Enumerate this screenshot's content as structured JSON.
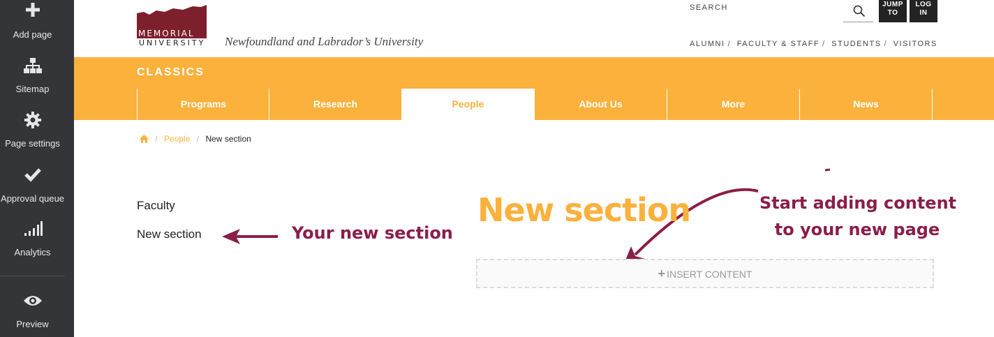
{
  "sidebar": {
    "items": [
      {
        "label": "Add page",
        "icon": "plus-icon"
      },
      {
        "label": "Sitemap",
        "icon": "sitemap-icon"
      },
      {
        "label": "Page settings",
        "icon": "gear-icon"
      },
      {
        "label": "Approval queue",
        "icon": "checkmark-icon"
      },
      {
        "label": "Analytics",
        "icon": "bar-chart-icon"
      },
      {
        "label": "Preview",
        "icon": "eye-icon"
      }
    ]
  },
  "header": {
    "logo_line1": "MEMORIAL",
    "logo_line2": "UNIVERSITY",
    "tagline": "Newfoundland and Labrador’s University",
    "search_label": "SEARCH",
    "jump_to": [
      "JUMP",
      "TO"
    ],
    "log_in": [
      "LOG",
      "IN"
    ],
    "audience_links": [
      "ALUMNI",
      "FACULTY & STAFF",
      "STUDENTS",
      "VISITORS"
    ]
  },
  "department": "CLASSICS",
  "nav": {
    "tabs": [
      "Programs",
      "Research",
      "People",
      "About Us",
      "More",
      "News"
    ],
    "active": "People"
  },
  "breadcrumb": {
    "items": [
      "People",
      "New section"
    ]
  },
  "side_nav": [
    "Faculty",
    "New section"
  ],
  "main": {
    "heading": "New section",
    "insert_label": "INSERT CONTENT"
  },
  "annotations": {
    "left": "Your new section",
    "right_line1": "Start adding content",
    "right_line2": "to your new page"
  },
  "colors": {
    "sidebar_bg": "#333538",
    "accent": "#fbb13c",
    "brand_maroon": "#8b1d4a",
    "logo_maroon": "#7d1f2c"
  }
}
